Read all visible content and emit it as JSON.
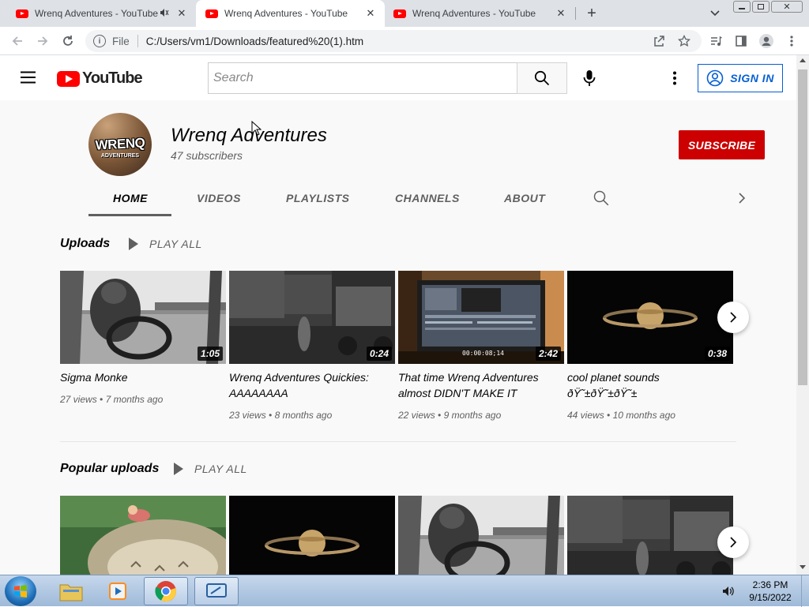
{
  "browser": {
    "tabs": [
      {
        "title": "Wrenq Adventures - YouTube",
        "audio": true,
        "active": false
      },
      {
        "title": "Wrenq Adventures - YouTube",
        "audio": false,
        "active": true
      },
      {
        "title": "Wrenq Adventures - YouTube",
        "audio": false,
        "active": false
      }
    ],
    "new_tab_label": "+",
    "address": {
      "scheme_label": "File",
      "url": "C:/Users/vm1/Downloads/featured%20(1).htm"
    }
  },
  "youtube": {
    "logo_text": "YouTube",
    "search_placeholder": "Search",
    "signin_label": "SIGN IN"
  },
  "channel": {
    "name": "Wrenq Adventures",
    "subscribers": "47 subscribers",
    "avatar_text": "WRENQ",
    "avatar_subtext": "ADVENTURES",
    "subscribe_label": "SUBSCRIBE",
    "tabs": [
      {
        "label": "HOME",
        "active": true
      },
      {
        "label": "VIDEOS",
        "active": false
      },
      {
        "label": "PLAYLISTS",
        "active": false
      },
      {
        "label": "CHANNELS",
        "active": false
      },
      {
        "label": "ABOUT",
        "active": false
      }
    ]
  },
  "shelves": [
    {
      "title": "Uploads",
      "play_all": "PLAY ALL",
      "videos": [
        {
          "title": "Sigma Monke",
          "meta": [
            "27 views",
            "7 months ago"
          ],
          "duration": "1:05",
          "thumb": "monkey"
        },
        {
          "title": "Wrenq Adventures Quickies: AAAAAAAA",
          "meta": [
            "23 views",
            "8 months ago"
          ],
          "duration": "0:24",
          "thumb": "street"
        },
        {
          "title": "That time Wrenq Adventures almost DIDN'T MAKE IT",
          "meta": [
            "22 views",
            "9 months ago"
          ],
          "duration": "2:42",
          "thumb": "monitor",
          "overlay_text": "00:00:08;14"
        },
        {
          "title": "cool planet sounds ðŸ˜±ðŸ˜±ðŸ˜±",
          "meta": [
            "44 views",
            "10 months ago"
          ],
          "duration": "0:38",
          "thumb": "planet"
        }
      ]
    },
    {
      "title": "Popular uploads",
      "play_all": "PLAY ALL",
      "videos": [
        {
          "thumb": "totoro"
        },
        {
          "thumb": "planet"
        },
        {
          "thumb": "monkey"
        },
        {
          "thumb": "street"
        }
      ]
    }
  ],
  "taskbar": {
    "time": "2:36 PM",
    "date": "9/15/2022"
  },
  "colors": {
    "yt_red": "#ff0000",
    "subscribe_red": "#cc0000",
    "signin_blue": "#065fd4"
  }
}
